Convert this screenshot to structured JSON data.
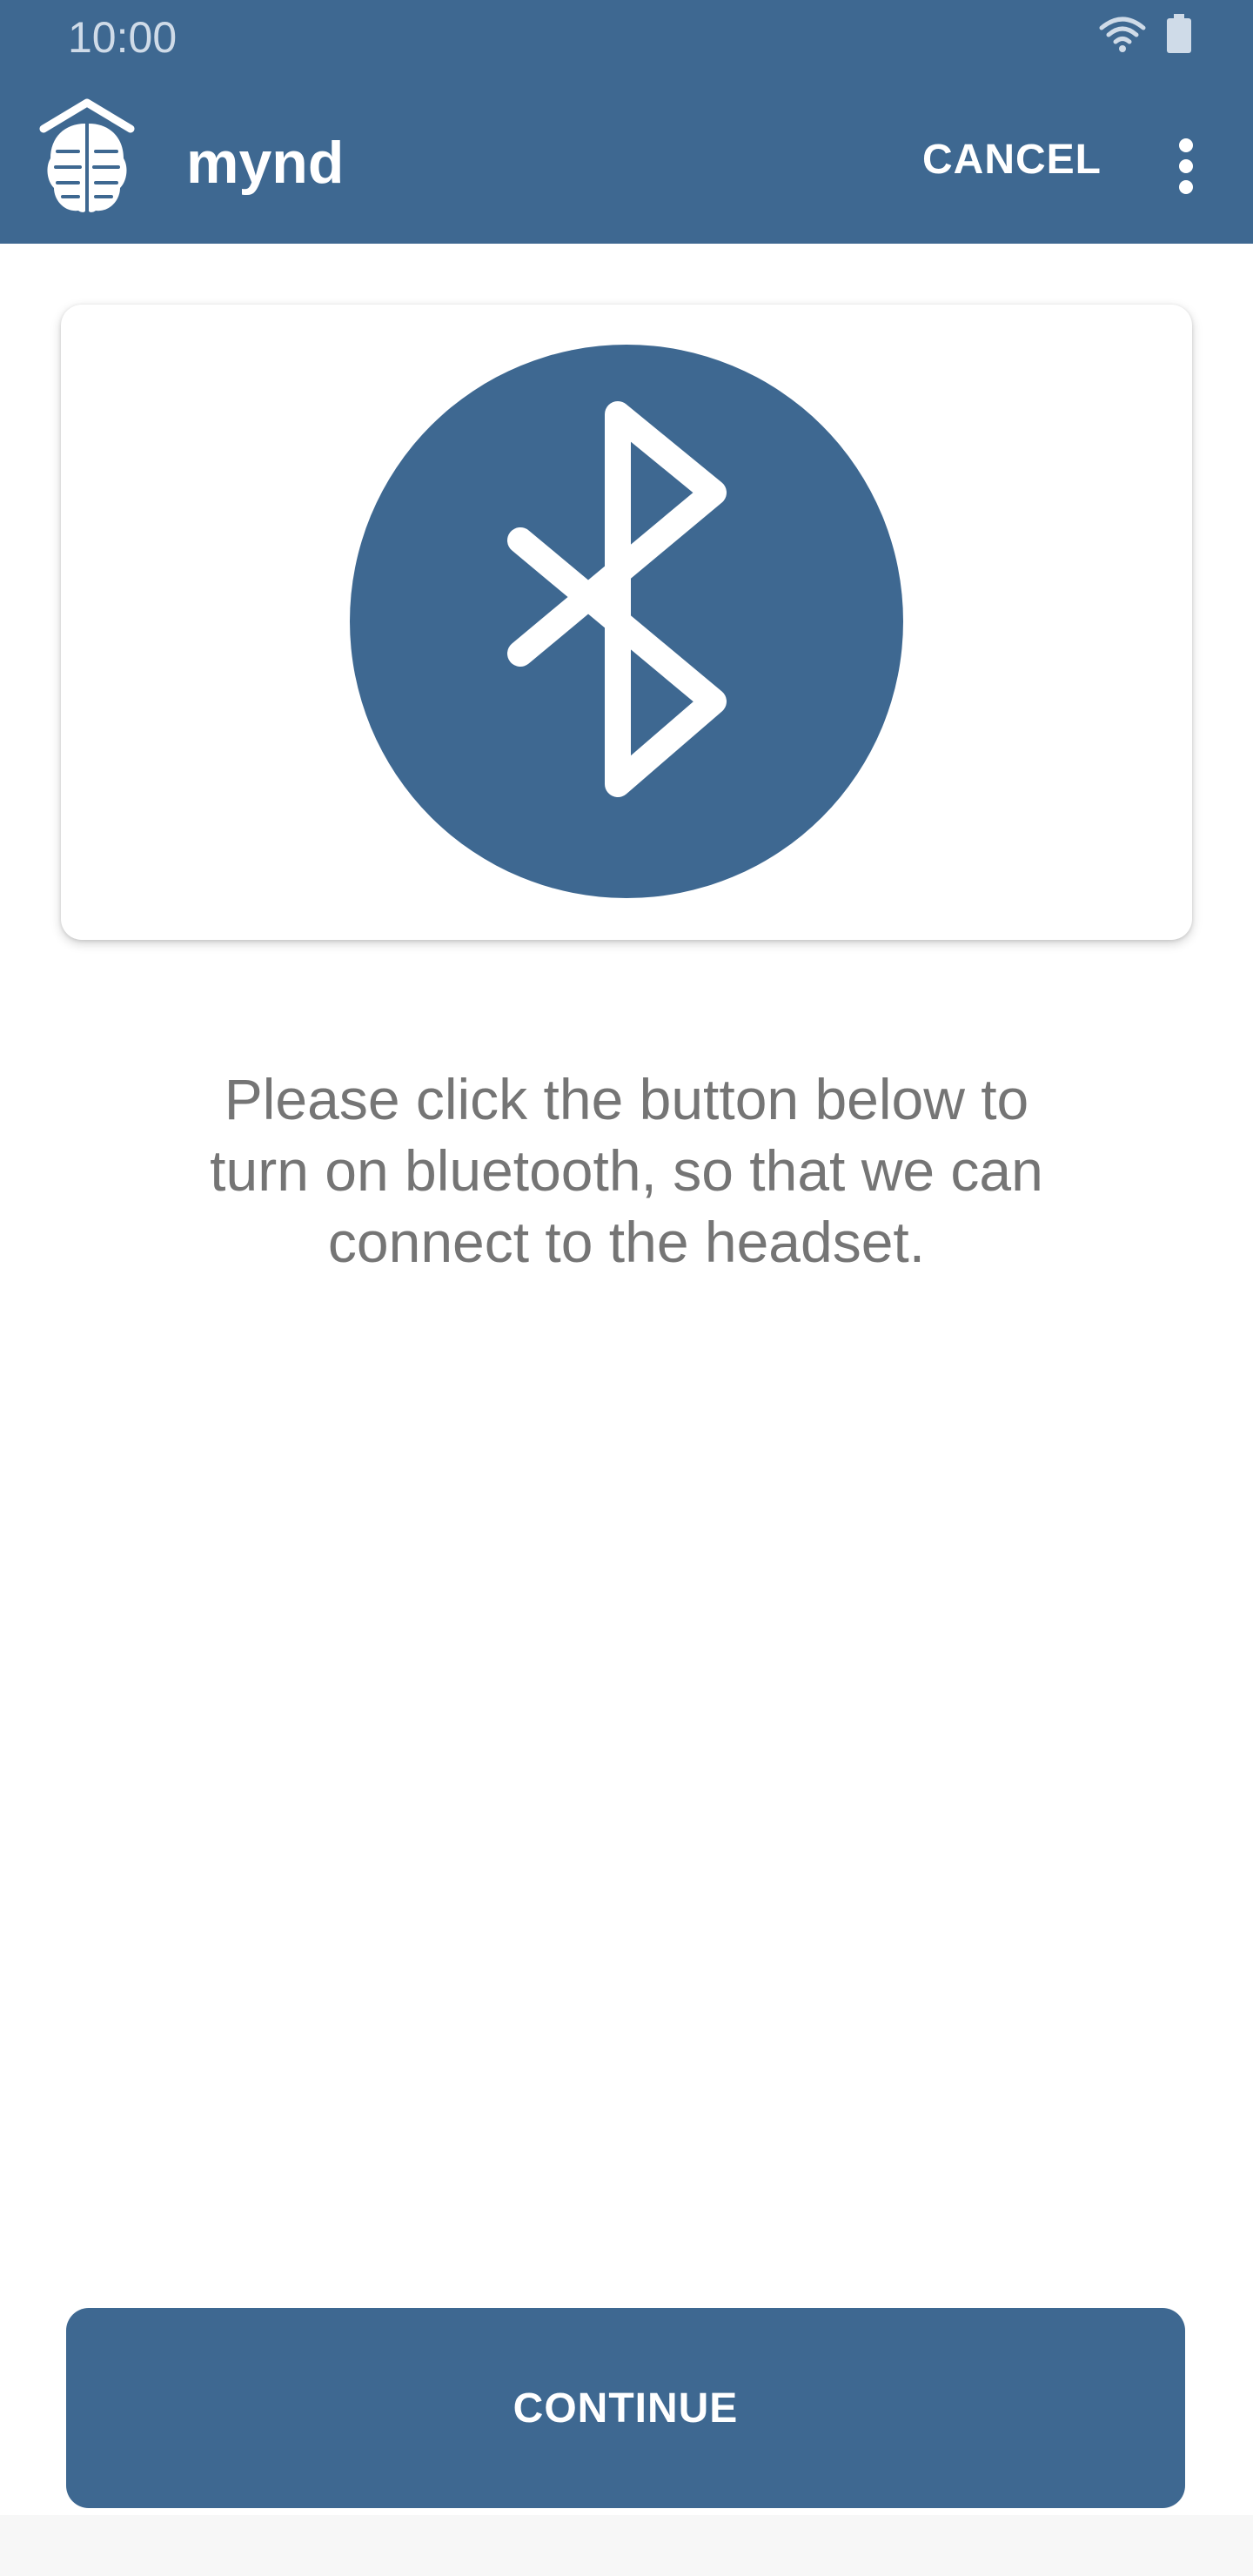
{
  "status_bar": {
    "time": "10:00",
    "icons": [
      "wifi-icon",
      "battery-icon"
    ]
  },
  "app_bar": {
    "title": "mynd",
    "logo_icon": "brain-logo-icon",
    "cancel_label": "CANCEL",
    "menu_icon": "more-vert-icon"
  },
  "hero": {
    "icon": "bluetooth-icon"
  },
  "instruction": {
    "line1": "Please click the button below to",
    "line2": "turn on bluetooth, so that we can",
    "line3": "connect to the headset."
  },
  "footer": {
    "continue_label": "CONTINUE"
  },
  "colors": {
    "primary": "#3e6891",
    "text_secondary": "#757575",
    "background": "#ffffff"
  }
}
